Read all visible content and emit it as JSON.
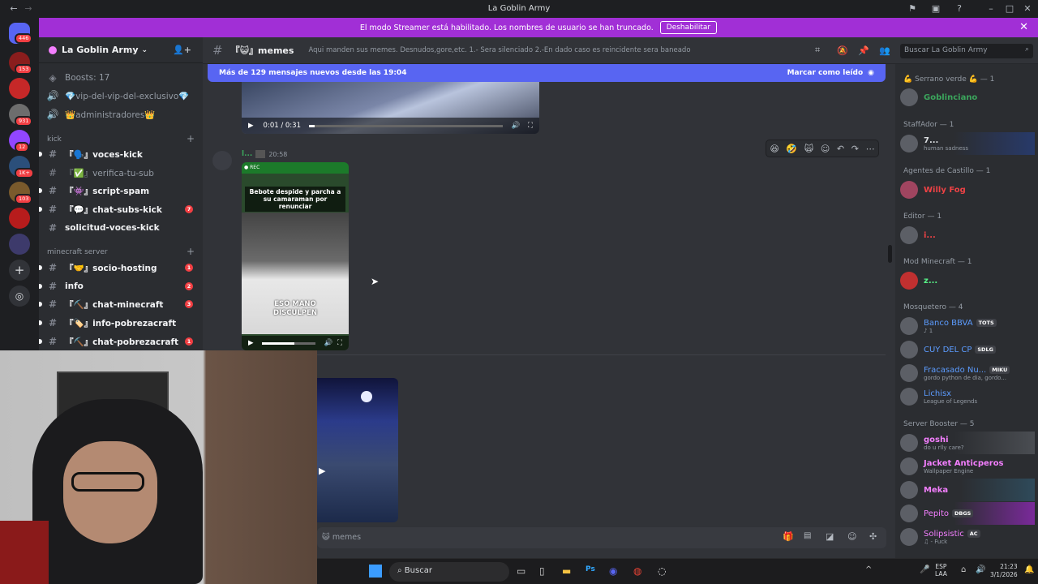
{
  "window": {
    "title": "La Goblin Army"
  },
  "banner": {
    "text": "El modo Streamer está habilitado. Los nombres de usuario se han truncado.",
    "button": "Deshabilitar"
  },
  "guilds": [
    {
      "badge": "446"
    },
    {
      "badge": "153"
    },
    {
      "badge": ""
    },
    {
      "badge": "931"
    },
    {
      "badge": "12"
    },
    {
      "badge": "1K+"
    },
    {
      "badge": "103"
    },
    {
      "badge": ""
    },
    {
      "badge": ""
    }
  ],
  "server": {
    "name": "La Goblin Army"
  },
  "sidebar": {
    "boosts": "Boosts: 17",
    "top_channels": [
      "💎vip-del-vip-del-exclusivo💎",
      "👑administradores👑"
    ],
    "categories": [
      "kick",
      "minecraft server"
    ],
    "kick_channels": [
      {
        "label": "『🗣️』voces-kick",
        "badge": ""
      },
      {
        "label": "『✅』verifica-tu-sub",
        "badge": ""
      },
      {
        "label": "『👾』script-spam",
        "badge": ""
      },
      {
        "label": "『💬』chat-subs-kick",
        "badge": "7"
      },
      {
        "label": "solicitud-voces-kick",
        "badge": ""
      }
    ],
    "mc_channels": [
      {
        "label": "『🤝』socio-hosting",
        "badge": "1"
      },
      {
        "label": "info",
        "badge": "2"
      },
      {
        "label": "『⛏️』chat-minecraft",
        "badge": "3"
      },
      {
        "label": "『🏷️』info-pobrezacraft",
        "badge": ""
      },
      {
        "label": "『⛏️』chat-pobrezacraft",
        "badge": "1"
      }
    ]
  },
  "channel": {
    "name": "『😺』memes",
    "topic": "Aqui manden sus memes. Desnudos,gore,etc. 1.- Sera silenciado 2.-En dado caso es reincidente sera baneado",
    "new_messages": "Más de 129 mensajes nuevos desde las 19:04",
    "mark_read": "Marcar como leído"
  },
  "message": {
    "author": "l...",
    "time": "20:58",
    "video1_time": "0:01 / 0:31",
    "video2_caption_top": "Bebote despide y parcha a su camaraman por renunciar",
    "video2_caption_bottom": "ESO MANO DISCULPEN"
  },
  "composer": {
    "placeholder": "😺 memes"
  },
  "members": {
    "search": "Buscar La Goblin Army",
    "groups": [
      {
        "role": "💪 Serrano verde 💪 — 1",
        "items": [
          {
            "name": "Goblinciano",
            "color": "#3ba55c",
            "status": "",
            "tag": ""
          }
        ]
      },
      {
        "role": "StaffAdor — 1",
        "items": [
          {
            "name": "7...",
            "color": "#dbdee1",
            "status": "human sadness",
            "tag": ""
          }
        ]
      },
      {
        "role": "Agentes de Castillo — 1",
        "items": [
          {
            "name": "Willy Fog",
            "color": "#ed4245",
            "status": "",
            "tag": ""
          }
        ]
      },
      {
        "role": "Editor — 1",
        "items": [
          {
            "name": "i...",
            "color": "#ed4245",
            "status": "",
            "tag": ""
          }
        ]
      },
      {
        "role": "Mod Minecraft — 1",
        "items": [
          {
            "name": "z...",
            "color": "#57f287",
            "status": "",
            "tag": ""
          }
        ]
      },
      {
        "role": "Mosquetero — 4",
        "items": [
          {
            "name": "Banco BBVA",
            "color": "#5c9cff",
            "status": "♪ 1",
            "tag": "TOTS"
          },
          {
            "name": "CUY DEL CP",
            "color": "#5c9cff",
            "status": "",
            "tag": "SDLG"
          },
          {
            "name": "Fracasado Nu...",
            "color": "#5c9cff",
            "status": "gordo python de dia, gordo...",
            "tag": "MIKU"
          },
          {
            "name": "Lichisx",
            "color": "#5c9cff",
            "status": "League of Legends",
            "tag": ""
          }
        ]
      },
      {
        "role": "Server Booster — 5",
        "items": [
          {
            "name": "goshi",
            "color": "#f47fff",
            "status": "do u rlly care?",
            "tag": ""
          },
          {
            "name": "Jacket Anticperos",
            "color": "#f47fff",
            "status": "Wallpaper Engine",
            "tag": ""
          },
          {
            "name": "Meka",
            "color": "#f47fff",
            "status": "",
            "tag": ""
          },
          {
            "name": "Pepito",
            "color": "#f47fff",
            "status": "",
            "tag": "DBGS"
          },
          {
            "name": "Solipsistic",
            "color": "#f47fff",
            "status": "♫ - Fuck",
            "tag": "AC"
          }
        ]
      }
    ]
  },
  "taskbar": {
    "search": "Buscar",
    "lang1": "ESP",
    "lang2": "LAA",
    "time": "21:23",
    "date": "3/1/2026"
  }
}
